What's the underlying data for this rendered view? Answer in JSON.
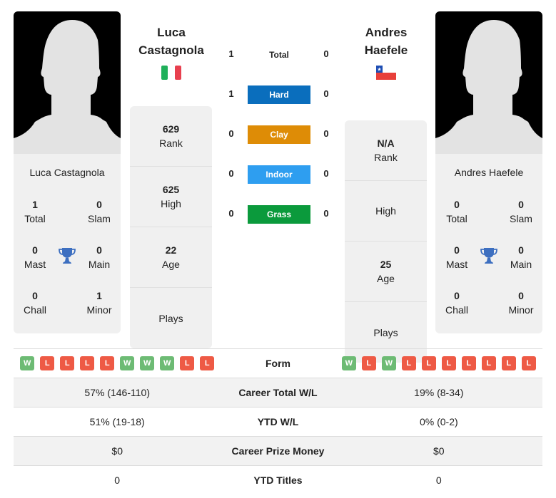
{
  "players": {
    "left": {
      "name_line1": "Luca",
      "name_line2": "Castagnola",
      "full_name": "Luca Castagnola",
      "country_flag": "italy-flag",
      "titles": {
        "total": {
          "value": "1",
          "label": "Total"
        },
        "slam": {
          "value": "0",
          "label": "Slam"
        },
        "mast": {
          "value": "0",
          "label": "Mast"
        },
        "main": {
          "value": "0",
          "label": "Main"
        },
        "chall": {
          "value": "0",
          "label": "Chall"
        },
        "minor": {
          "value": "1",
          "label": "Minor"
        }
      },
      "info": {
        "rank": {
          "value": "629",
          "label": "Rank"
        },
        "high": {
          "value": "625",
          "label": "High"
        },
        "age": {
          "value": "22",
          "label": "Age"
        },
        "plays": {
          "value": "",
          "label": "Plays"
        }
      }
    },
    "right": {
      "name_line1": "Andres",
      "name_line2": "Haefele",
      "full_name": "Andres Haefele",
      "country_flag": "chile-flag",
      "titles": {
        "total": {
          "value": "0",
          "label": "Total"
        },
        "slam": {
          "value": "0",
          "label": "Slam"
        },
        "mast": {
          "value": "0",
          "label": "Mast"
        },
        "main": {
          "value": "0",
          "label": "Main"
        },
        "chall": {
          "value": "0",
          "label": "Chall"
        },
        "minor": {
          "value": "0",
          "label": "Minor"
        }
      },
      "info": {
        "rank": {
          "value": "N/A",
          "label": "Rank"
        },
        "high": {
          "value": "",
          "label": "High"
        },
        "age": {
          "value": "25",
          "label": "Age"
        },
        "plays": {
          "value": "",
          "label": "Plays"
        }
      }
    }
  },
  "h2h": {
    "total": {
      "label": "Total",
      "left": "1",
      "right": "0"
    },
    "surfaces": [
      {
        "label": "Hard",
        "left": "1",
        "right": "0",
        "color": "#0a6ebd"
      },
      {
        "label": "Clay",
        "left": "0",
        "right": "0",
        "color": "#de8c06"
      },
      {
        "label": "Indoor",
        "left": "0",
        "right": "0",
        "color": "#2e9ef0"
      },
      {
        "label": "Grass",
        "left": "0",
        "right": "0",
        "color": "#0b9a3c"
      }
    ]
  },
  "comparison": {
    "form_label": "Form",
    "left_form": [
      "W",
      "L",
      "L",
      "L",
      "L",
      "W",
      "W",
      "W",
      "L",
      "L"
    ],
    "right_form": [
      "W",
      "L",
      "W",
      "L",
      "L",
      "L",
      "L",
      "L",
      "L",
      "L"
    ],
    "rows": [
      {
        "label": "Career Total W/L",
        "left": "57% (146-110)",
        "right": "19% (8-34)"
      },
      {
        "label": "YTD W/L",
        "left": "51% (19-18)",
        "right": "0% (0-2)"
      },
      {
        "label": "Career Prize Money",
        "left": "$0",
        "right": "$0"
      },
      {
        "label": "YTD Titles",
        "left": "0",
        "right": "0"
      }
    ]
  },
  "colors": {
    "win": "#6dbb74",
    "loss": "#ee5a45",
    "trophy": "#3d6fc0"
  }
}
